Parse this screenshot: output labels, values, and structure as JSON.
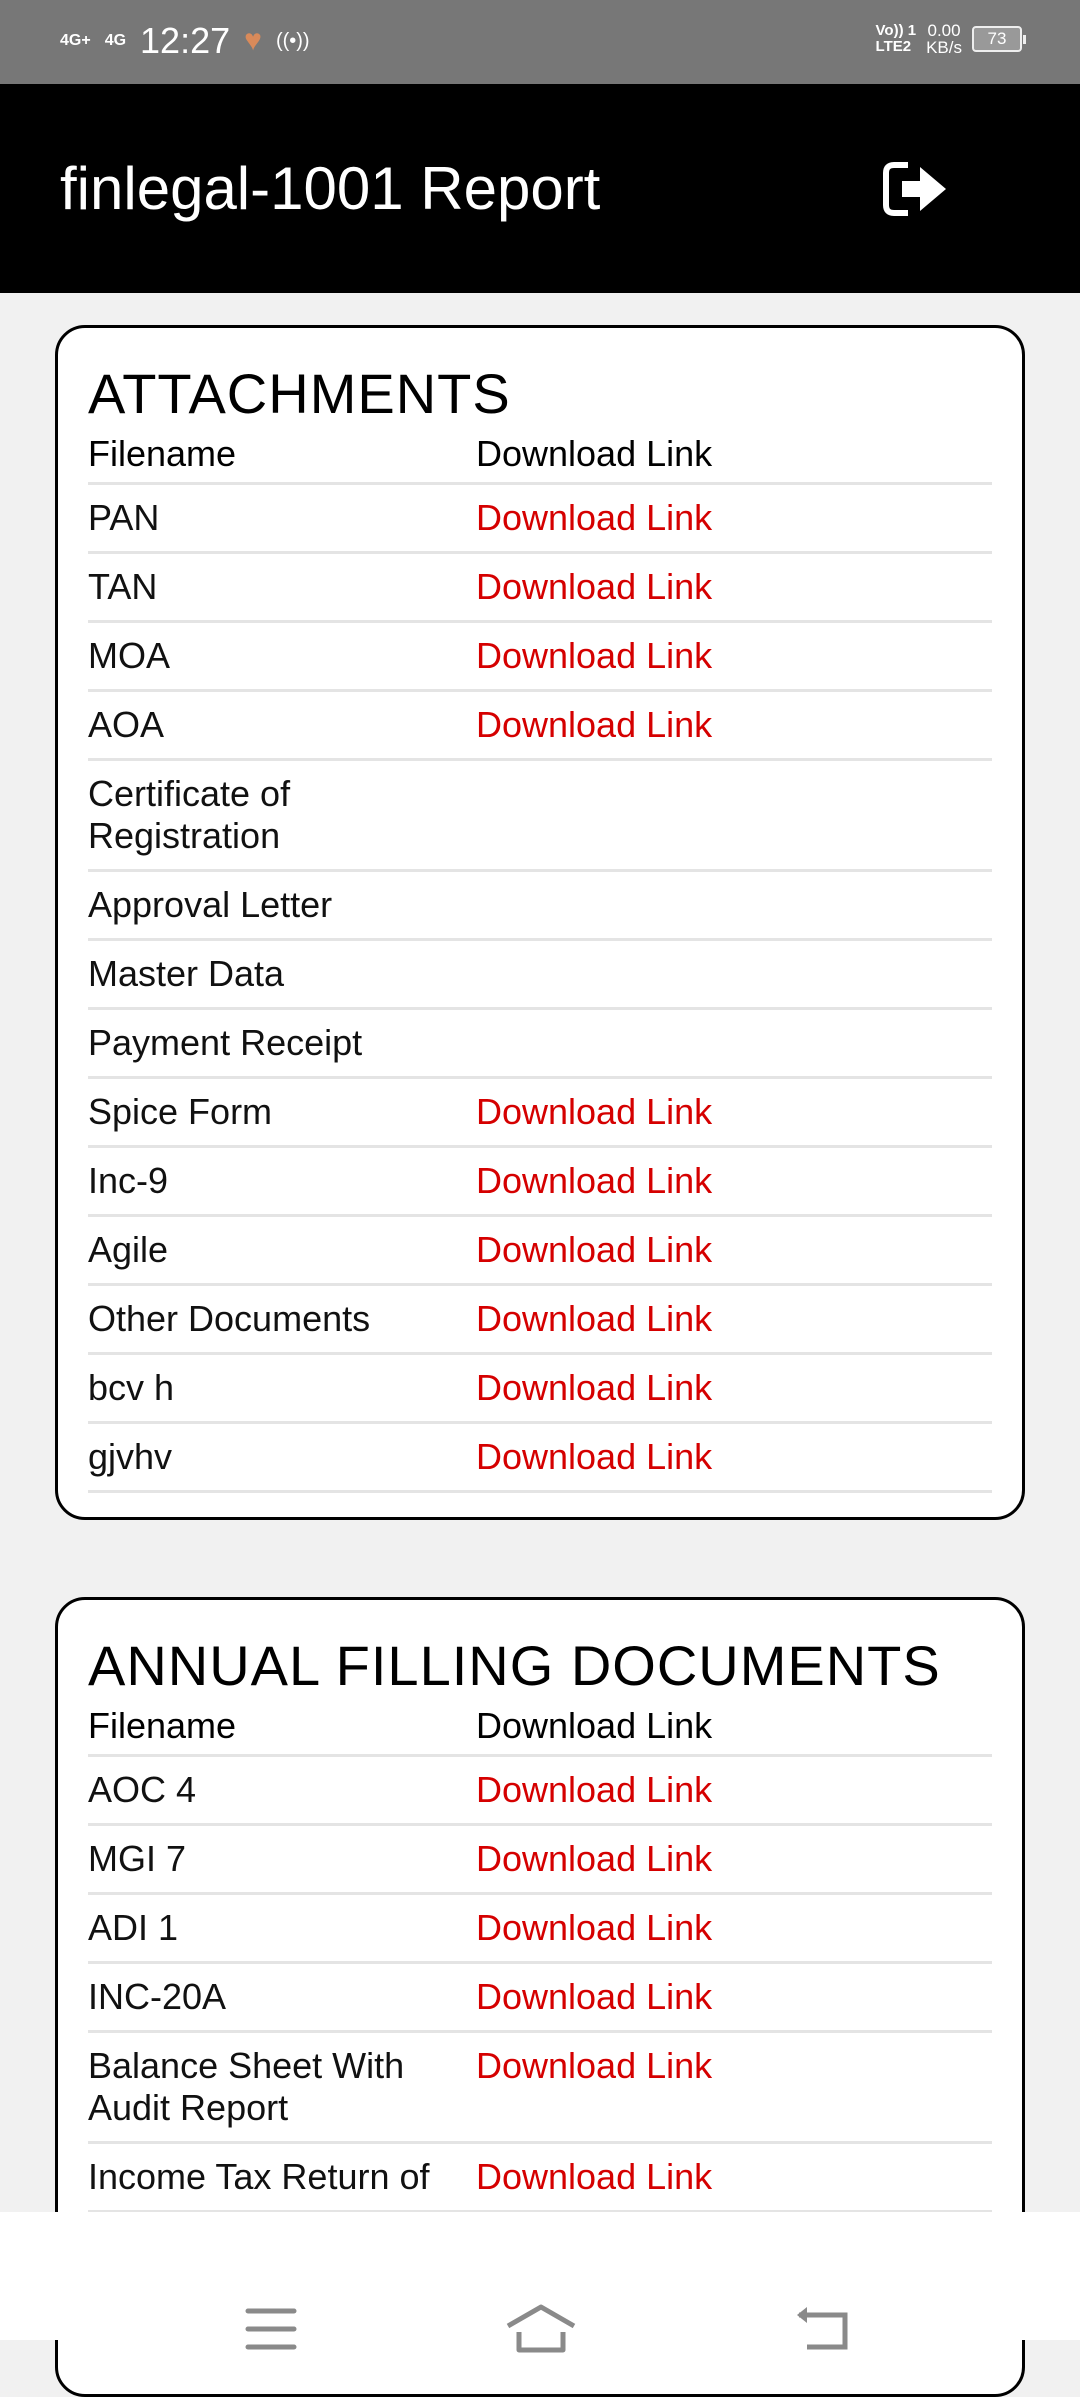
{
  "status_bar": {
    "network1": "4G+",
    "network2": "4G",
    "time": "12:27",
    "volte": "Vo)) 1",
    "lte": "LTE2",
    "speed_value": "0.00",
    "speed_unit": "KB/s",
    "battery": "73"
  },
  "header": {
    "title": "finlegal-1001 Report",
    "logout_icon": "sign-out-icon"
  },
  "sections": [
    {
      "title": "ATTACHMENTS",
      "col_filename": "Filename",
      "col_link": "Download Link",
      "rows": [
        {
          "name": "PAN",
          "link": "Download Link"
        },
        {
          "name": "TAN",
          "link": "Download Link"
        },
        {
          "name": "MOA",
          "link": "Download Link"
        },
        {
          "name": "AOA",
          "link": "Download Link"
        },
        {
          "name": "Certificate of Registration",
          "link": ""
        },
        {
          "name": "Approval Letter",
          "link": ""
        },
        {
          "name": "Master Data",
          "link": ""
        },
        {
          "name": "Payment Receipt",
          "link": ""
        },
        {
          "name": "Spice Form",
          "link": "Download Link"
        },
        {
          "name": "Inc-9",
          "link": "Download Link"
        },
        {
          "name": "Agile",
          "link": "Download Link"
        },
        {
          "name": "Other Documents",
          "link": "Download Link"
        },
        {
          "name": "bcv h",
          "link": "Download Link"
        },
        {
          "name": "gjvhv",
          "link": "Download Link"
        }
      ]
    },
    {
      "title": "ANNUAL FILLING DOCUMENTS",
      "col_filename": "Filename",
      "col_link": "Download Link",
      "rows": [
        {
          "name": "AOC 4",
          "link": "Download Link"
        },
        {
          "name": "MGI 7",
          "link": "Download Link"
        },
        {
          "name": "ADI 1",
          "link": "Download Link"
        },
        {
          "name": "INC-20A",
          "link": "Download Link"
        },
        {
          "name": "Balance Sheet With Audit Report",
          "link": "Download Link"
        },
        {
          "name": "Income Tax Return of",
          "link": "Download Link"
        }
      ]
    }
  ],
  "nav_bar": {
    "icons": [
      "menu-icon",
      "home-icon",
      "back-icon"
    ]
  },
  "colors": {
    "link": "#d50000",
    "header_bg": "#000000",
    "status_bg": "#777777"
  }
}
